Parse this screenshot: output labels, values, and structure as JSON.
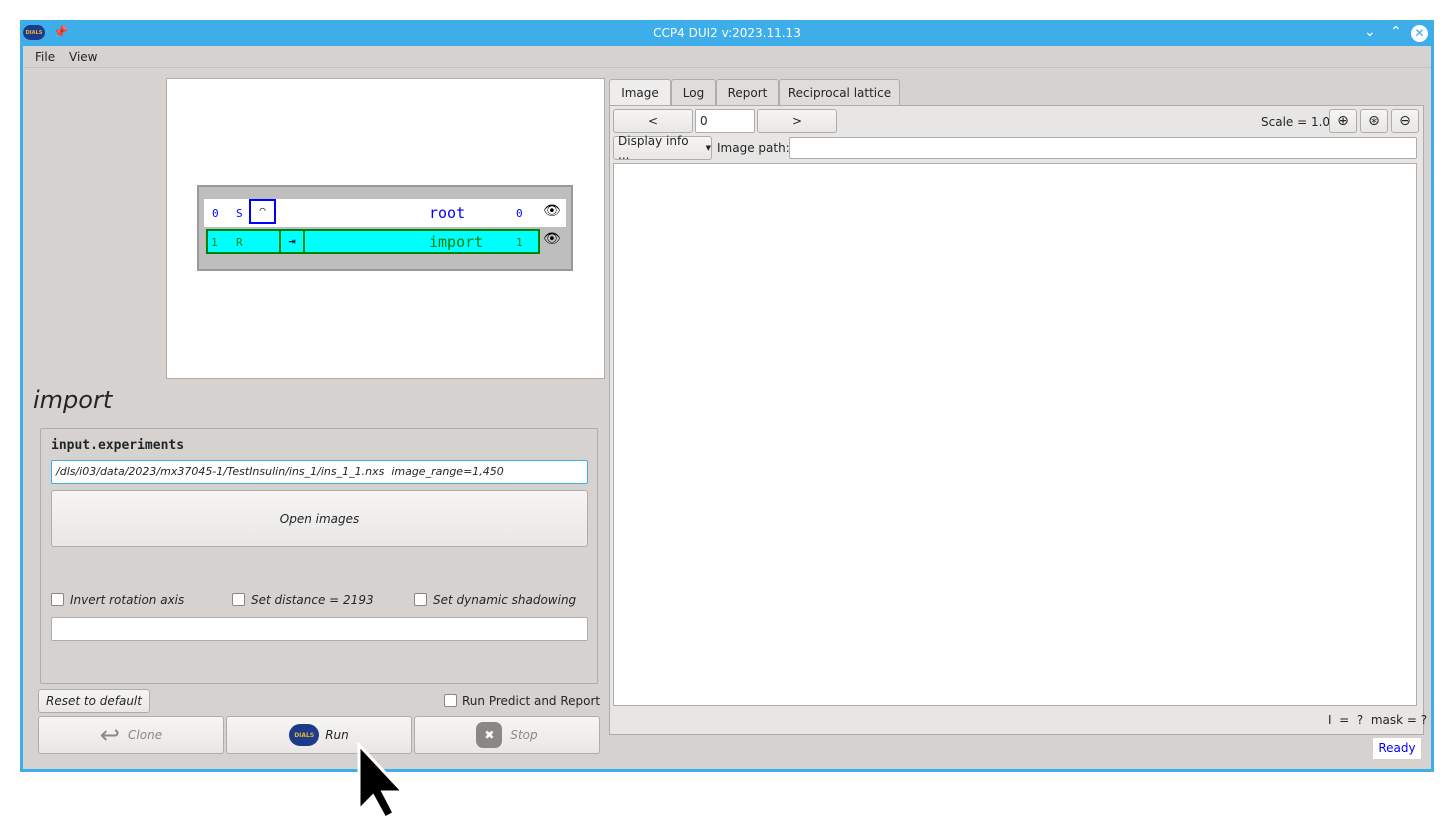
{
  "window": {
    "title": "CCP4 DUI2 v:2023.11.13",
    "logo_text": "DIALS"
  },
  "menu": [
    "File",
    "View"
  ],
  "tree": {
    "nodes": [
      {
        "num": "0",
        "status": "S",
        "name": "root",
        "children": "0"
      },
      {
        "num": "1",
        "status": "R",
        "name": "import",
        "children": "1"
      }
    ]
  },
  "step": {
    "title": "import",
    "param_label": "input.experiments",
    "path_value": "/dls/i03/data/2023/mx37045-1/TestInsulin/ins_1/ins_1_1.nxs  image_range=1,450",
    "open_images": "Open images",
    "checkboxes": [
      "Invert rotation axis",
      "Set distance = 2193",
      "Set dynamic shadowing"
    ],
    "extra_value": ""
  },
  "controls": {
    "reset": "Reset to default",
    "run_predict": "Run Predict and Report",
    "clone": "Clone",
    "run": "Run",
    "stop": "Stop"
  },
  "viewer": {
    "tabs": [
      "Image",
      "Log",
      "Report",
      "Reciprocal lattice"
    ],
    "active_tab": "Image",
    "prev": "<",
    "next": ">",
    "image_num": "0",
    "scale": "Scale = 1.00",
    "display_info": "Display info ...",
    "image_path_label": "Image path:",
    "image_path_value": "",
    "readout": "I  =  ?  mask = ?"
  },
  "status": "Ready",
  "colors": {
    "accent": "#3daee9",
    "selected_node": "#00ffff",
    "node_border": "#008000",
    "root_text": "#0000ff"
  }
}
